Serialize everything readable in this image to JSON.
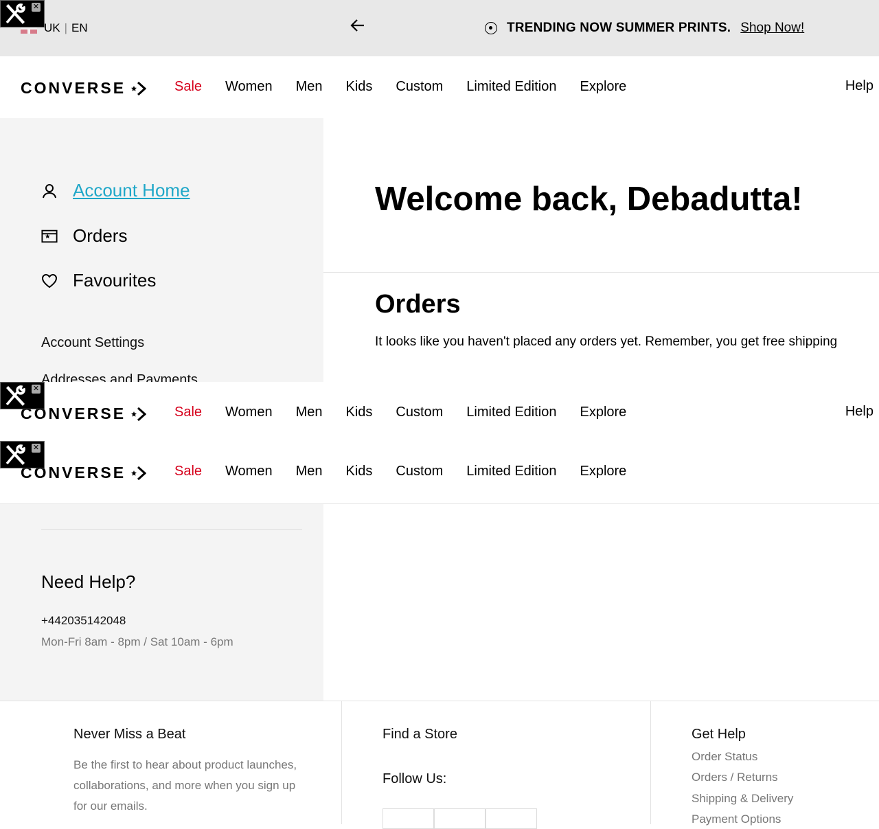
{
  "promo": {
    "locale_country": "UK",
    "locale_sep": "|",
    "locale_lang": "EN",
    "message": "TRENDING NOW SUMMER PRINTS.",
    "link": "Shop Now!"
  },
  "header": {
    "logo": "CONVERSE",
    "nav": [
      "Sale",
      "Women",
      "Men",
      "Kids",
      "Custom",
      "Limited Edition",
      "Explore"
    ],
    "help": "Help",
    "sale_color": "#d6001c"
  },
  "sidebar": {
    "account_home": "Account Home",
    "orders": "Orders",
    "favourites": "Favourites",
    "account_settings": "Account Settings",
    "addresses": "Addresses and Payments",
    "need_help": "Need Help?",
    "phone": "+442035142048",
    "hours": "Mon-Fri 8am - 8pm / Sat 10am - 6pm",
    "active_color": "#1fa7c8"
  },
  "main": {
    "welcome": "Welcome back, Debadutta!",
    "orders_title": "Orders",
    "orders_text": "It looks like you haven't placed any orders yet. Remember, you get free shipping"
  },
  "footer": {
    "newsletter_title": "Never Miss a Beat",
    "newsletter_text": "Be the first to hear about product launches, collaborations, and more when you sign up for our emails.",
    "find_store": "Find a Store",
    "follow_us": "Follow Us:",
    "get_help": "Get Help",
    "help_links": [
      "Order Status",
      "Orders / Returns",
      "Shipping & Delivery",
      "Payment Options"
    ]
  }
}
